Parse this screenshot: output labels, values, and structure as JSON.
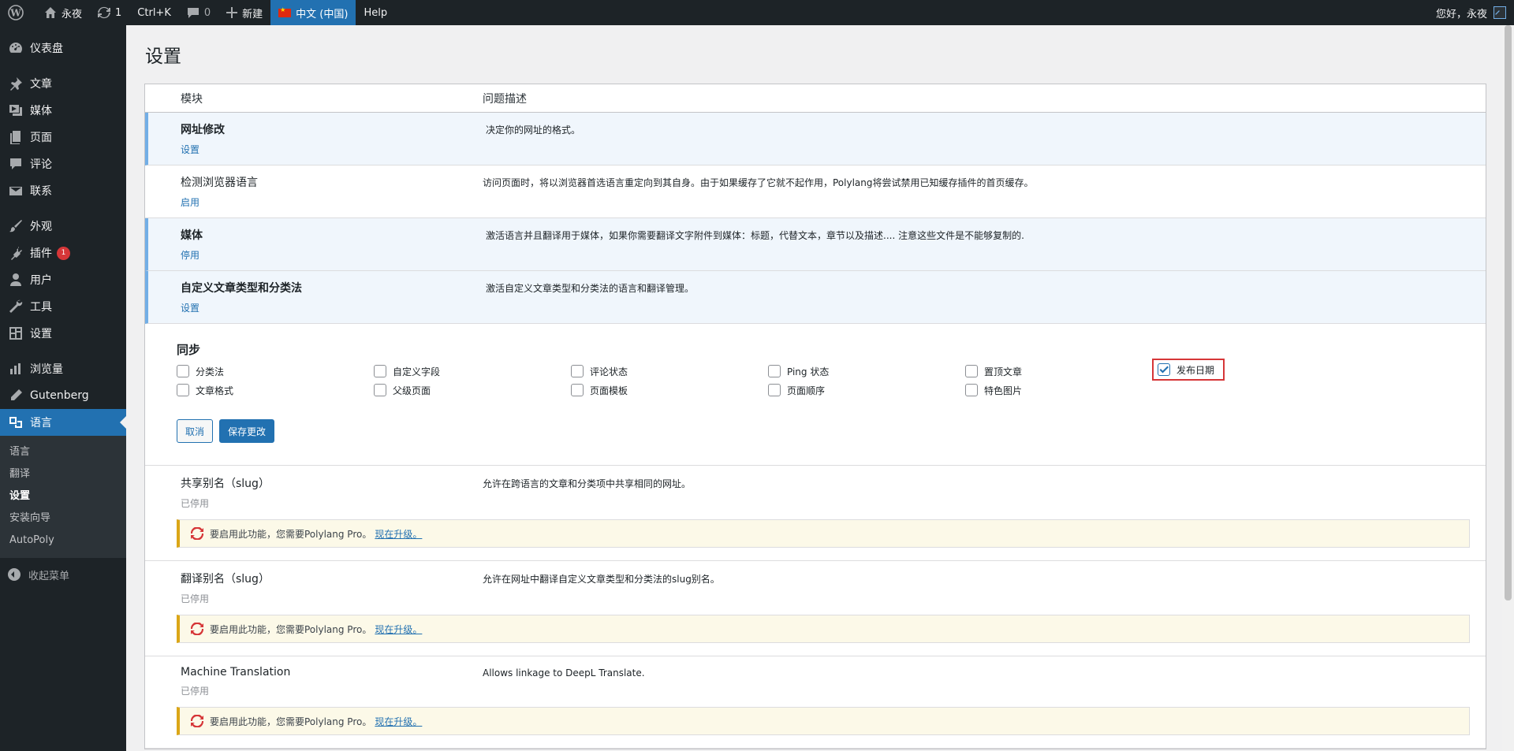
{
  "adminbar": {
    "site_name": "永夜",
    "updates_count": "1",
    "shortcut": "Ctrl+K",
    "comments_count": "0",
    "new_label": "新建",
    "language": "中文 (中国)",
    "help": "Help",
    "greeting": "您好，永夜"
  },
  "sidebar": {
    "items": [
      {
        "label": "仪表盘"
      },
      {
        "label": "文章"
      },
      {
        "label": "媒体"
      },
      {
        "label": "页面"
      },
      {
        "label": "评论"
      },
      {
        "label": "联系"
      },
      {
        "label": "外观"
      },
      {
        "label": "插件",
        "badge": "1"
      },
      {
        "label": "用户"
      },
      {
        "label": "工具"
      },
      {
        "label": "设置"
      },
      {
        "label": "浏览量"
      },
      {
        "label": "Gutenberg"
      },
      {
        "label": "语言"
      }
    ],
    "submenu": [
      "语言",
      "翻译",
      "设置",
      "安装向导",
      "AutoPoly"
    ],
    "collapse": "收起菜单"
  },
  "page": {
    "title": "设置",
    "col_module": "模块",
    "col_desc": "问题描述"
  },
  "modules": [
    {
      "name": "网址修改",
      "action": "设置",
      "desc": "决定你的网址的格式。"
    },
    {
      "name": "检测浏览器语言",
      "action": "启用",
      "desc": "访问页面时，将以浏览器首选语言重定向到其自身。由于如果缓存了它就不起作用，Polylang将尝试禁用已知缓存插件的首页缓存。"
    },
    {
      "name": "媒体",
      "action": "停用",
      "desc": "激活语言并且翻译用于媒体，如果你需要翻译文字附件到媒体：标题，代替文本，章节以及描述.... 注意这些文件是不能够复制的."
    },
    {
      "name": "自定义文章类型和分类法",
      "action": "设置",
      "desc": "激活自定义文章类型和分类法的语言和翻译管理。"
    }
  ],
  "sync": {
    "title": "同步",
    "options": [
      {
        "label": "分类法",
        "checked": false
      },
      {
        "label": "自定义字段",
        "checked": false
      },
      {
        "label": "评论状态",
        "checked": false
      },
      {
        "label": "Ping 状态",
        "checked": false
      },
      {
        "label": "置顶文章",
        "checked": false
      },
      {
        "label": "发布日期",
        "checked": true
      },
      {
        "label": "文章格式",
        "checked": false
      },
      {
        "label": "父级页面",
        "checked": false
      },
      {
        "label": "页面模板",
        "checked": false
      },
      {
        "label": "页面顺序",
        "checked": false
      },
      {
        "label": "特色图片",
        "checked": false
      }
    ],
    "cancel": "取消",
    "save": "保存更改"
  },
  "pro_modules": [
    {
      "name": "共享别名（slug）",
      "status": "已停用",
      "desc": "允许在跨语言的文章和分类项中共享相同的网址。"
    },
    {
      "name": "翻译别名（slug）",
      "status": "已停用",
      "desc": "允许在网址中翻译自定义文章类型和分类法的slug别名。"
    },
    {
      "name": "Machine Translation",
      "status": "已停用",
      "desc": "Allows linkage to DeepL Translate."
    }
  ],
  "notice": {
    "text": "要启用此功能，您需要Polylang Pro。",
    "link": "现在升级。"
  }
}
